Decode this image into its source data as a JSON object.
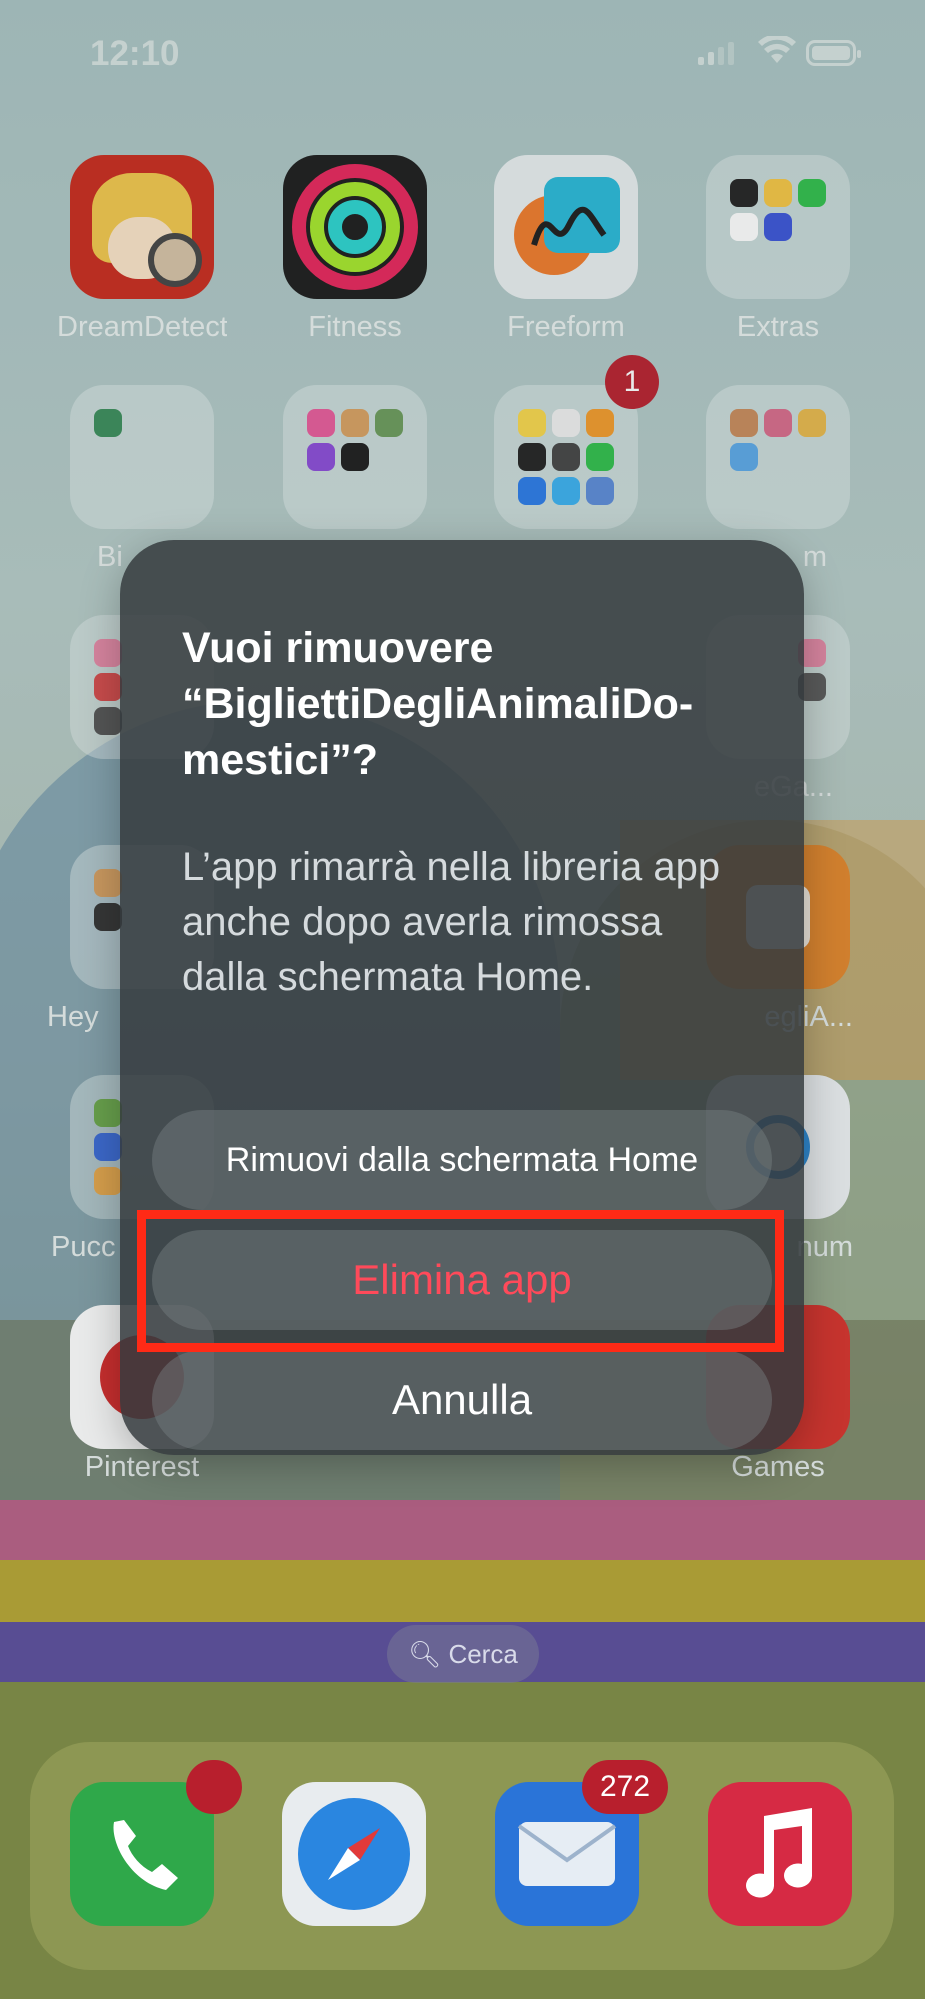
{
  "status_bar": {
    "time": "12:10"
  },
  "home_apps": [
    {
      "label": "DreamDetecti..."
    },
    {
      "label": "Fitness"
    },
    {
      "label": "Freeform"
    },
    {
      "label": "Extras"
    },
    {
      "label": "Bi"
    },
    {
      "label": ""
    },
    {
      "label": "",
      "badge": "1"
    },
    {
      "label": "m"
    },
    {
      "label": "Hey"
    },
    {
      "label": "egliA..."
    },
    {
      "label": "Pucc"
    },
    {
      "label": "num"
    },
    {
      "label": "Pinterest"
    },
    {
      "label": "Games"
    },
    {
      "label": "eGa..."
    }
  ],
  "search": {
    "label": "Cerca"
  },
  "dock": {
    "phone_badge": "",
    "mail_badge": "272"
  },
  "alert": {
    "title": "Vuoi rimuovere “BigliettiDegliAnimaliDo-mestici”?",
    "message": "L’app rimarrà nella libreria app anche dopo averla rimossa dalla schermata Home.",
    "remove_label": "Rimuovi dalla schermata Home",
    "delete_label": "Elimina app",
    "cancel_label": "Annulla"
  },
  "colors": {
    "destructive": "#ff4a5a",
    "highlight": "#ff2a16",
    "badge": "#b81f2d"
  }
}
